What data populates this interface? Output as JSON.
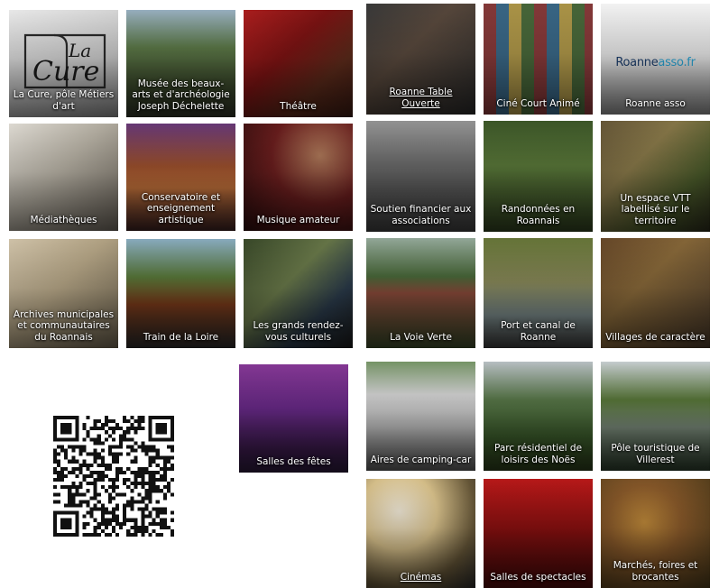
{
  "tiles": [
    {
      "id": "la-cure",
      "label": "La Cure, pôle Métiers d'art",
      "underline": false,
      "bg": "linear-gradient(160deg,#f4f4f4 0%,#c9c9c9 55%,#8a8a8a 100%)"
    },
    {
      "id": "musee",
      "label": "Musée des beaux-arts et d'archéologie Joseph Déchelette",
      "underline": false,
      "bg": "linear-gradient(180deg,#9fb7c9 0%,#5d7a48 35%,#3c4a2c 70%,#2e3225 100%)"
    },
    {
      "id": "theatre",
      "label": "Théâtre",
      "underline": false,
      "bg": "linear-gradient(135deg,#b21f1f 0%,#7d1313 40%,#5b2a1a 70%,#3a1a12 100%)"
    },
    {
      "id": "roanne-table",
      "label": "Roanne Table Ouverte",
      "underline": true,
      "bg": "linear-gradient(135deg,#3b3b3b 0%,#5a4a3e 40%,#2a2a2a 100%)"
    },
    {
      "id": "cine-court",
      "label": "Ciné Court Animé",
      "underline": false,
      "bg": "repeating-linear-gradient(90deg,#8a3b3b 0 14px,#3b6a8a 14px 28px,#b29a4a 28px 42px,#4a6a3b 42px 56px)"
    },
    {
      "id": "roanne-asso",
      "label": "Roanne asso",
      "underline": false,
      "bg": "linear-gradient(180deg,#ffffff 0%,#e6e6e6 50%,#8f8f8f 100%)"
    },
    {
      "id": "mediatheques",
      "label": "Médiathèques",
      "underline": false,
      "bg": "linear-gradient(135deg,#e8e4dc 0%,#b9b3a6 45%,#6d665c 100%)"
    },
    {
      "id": "conservatoire",
      "label": "Conservatoire et enseignement artistique",
      "underline": false,
      "bg": "linear-gradient(180deg,#6a3a7a 0%,#a0522d 40%,#c0703a 60%,#3a2020 100%)"
    },
    {
      "id": "musique",
      "label": "Musique amateur",
      "underline": false,
      "bg": "radial-gradient(circle at 70% 30%,#b07a5a 0%,#6b1e1e 45%,#2a0c0c 100%)"
    },
    {
      "id": "soutien",
      "label": "Soutien financier aux associations",
      "underline": false,
      "bg": "linear-gradient(180deg,#9a9a9a 0%,#6b6b6b 40%,#3d3d3d 100%)"
    },
    {
      "id": "randonnees",
      "label": "Randonnées en Roannais",
      "underline": false,
      "bg": "linear-gradient(180deg,#3f5a2a 0%,#5b7a3a 40%,#2f3f1f 100%)"
    },
    {
      "id": "vtt",
      "label": "Un espace VTT labellisé sur le territoire",
      "underline": false,
      "bg": "linear-gradient(135deg,#6a5a3a 0%,#8a7a4a 35%,#4a5a2a 70%,#2a2a1a 100%)"
    },
    {
      "id": "archives",
      "label": "Archives municipales et communautaires du Roannais",
      "underline": false,
      "bg": "linear-gradient(135deg,#d9cbb0 0%,#b8a888 45%,#6e6450 100%)"
    },
    {
      "id": "train",
      "label": "Train de la Loire",
      "underline": false,
      "bg": "linear-gradient(180deg,#8fb3c8 0%,#5a7a3a 35%,#7a3a1a 60%,#2a2a2a 100%)"
    },
    {
      "id": "rendezvous",
      "label": "Les grands rendez-vous culturels",
      "underline": false,
      "bg": "linear-gradient(135deg,#3a4a2a 0%,#6a7a4a 40%,#2a3a4a 70%,#1a1a1a 100%)"
    },
    {
      "id": "voie-verte",
      "label": "La Voie Verte",
      "underline": false,
      "bg": "linear-gradient(180deg,#9ab0a0 0%,#4a6a3a 35%,#8a4a3a 50%,#3a4a2a 100%)"
    },
    {
      "id": "port",
      "label": "Port et canal de Roanne",
      "underline": false,
      "bg": "linear-gradient(180deg,#6a7a3a 0%,#8a8a5a 40%,#7a8a8a 70%,#3a3a3a 100%)"
    },
    {
      "id": "villages",
      "label": "Villages de caractère",
      "underline": false,
      "bg": "linear-gradient(135deg,#6a4a2a 0%,#8a6a3a 40%,#4a3a2a 100%)"
    },
    {
      "id": "salles-fetes",
      "label": "Salles des fêtes",
      "underline": false,
      "bg": "linear-gradient(180deg,#8a3a9a 0%,#6a2a8a 40%,#3a1a4a 80%,#2a1a3a 100%)"
    },
    {
      "id": "aires",
      "label": "Aires de camping-car",
      "underline": false,
      "bg": "linear-gradient(180deg,#7a9a6a 0%,#dcdcdc 30%,#bfbfbf 60%,#5a5a5a 100%)"
    },
    {
      "id": "parc",
      "label": "Parc résidentiel de loisirs des Noës",
      "underline": false,
      "bg": "linear-gradient(180deg,#c0c8cc 0%,#5a7a4a 35%,#3a5a2a 70%,#2a3a1a 100%)"
    },
    {
      "id": "pole-touristique",
      "label": "Pôle touristique de Villerest",
      "underline": false,
      "bg": "linear-gradient(180deg,#cfd6d9 0%,#5a7a3a 35%,#7a8a7a 60%,#2a3a2a 100%)"
    },
    {
      "id": "cinemas",
      "label": "Cinémas",
      "underline": true,
      "bg": "radial-gradient(circle at 30% 30%,#f2ead8 0%,#e0c890 35%,#6a5a3a 70%,#2a2a2a 100%)"
    },
    {
      "id": "spectacles",
      "label": "Salles de spectacles",
      "underline": false,
      "bg": "linear-gradient(180deg,#c01a1a 0%,#8a1010 45%,#4a0a0a 100%)"
    },
    {
      "id": "marches",
      "label": "Marchés, foires et brocantes",
      "underline": false,
      "bg": "radial-gradient(circle at 40% 40%,#c08a3a 0%,#8a5a2a 40%,#4a3a1a 100%)"
    }
  ],
  "logos": {
    "cure_text_la": "La",
    "cure_text_cure": "Cure",
    "roanne_part1": "Roanne",
    "roanne_part2": "asso.fr",
    "color_roanne_dark": "#1d3f6e",
    "color_roanne_light": "#2aa7d8"
  },
  "qr": {
    "icon": "qr-code-icon"
  }
}
